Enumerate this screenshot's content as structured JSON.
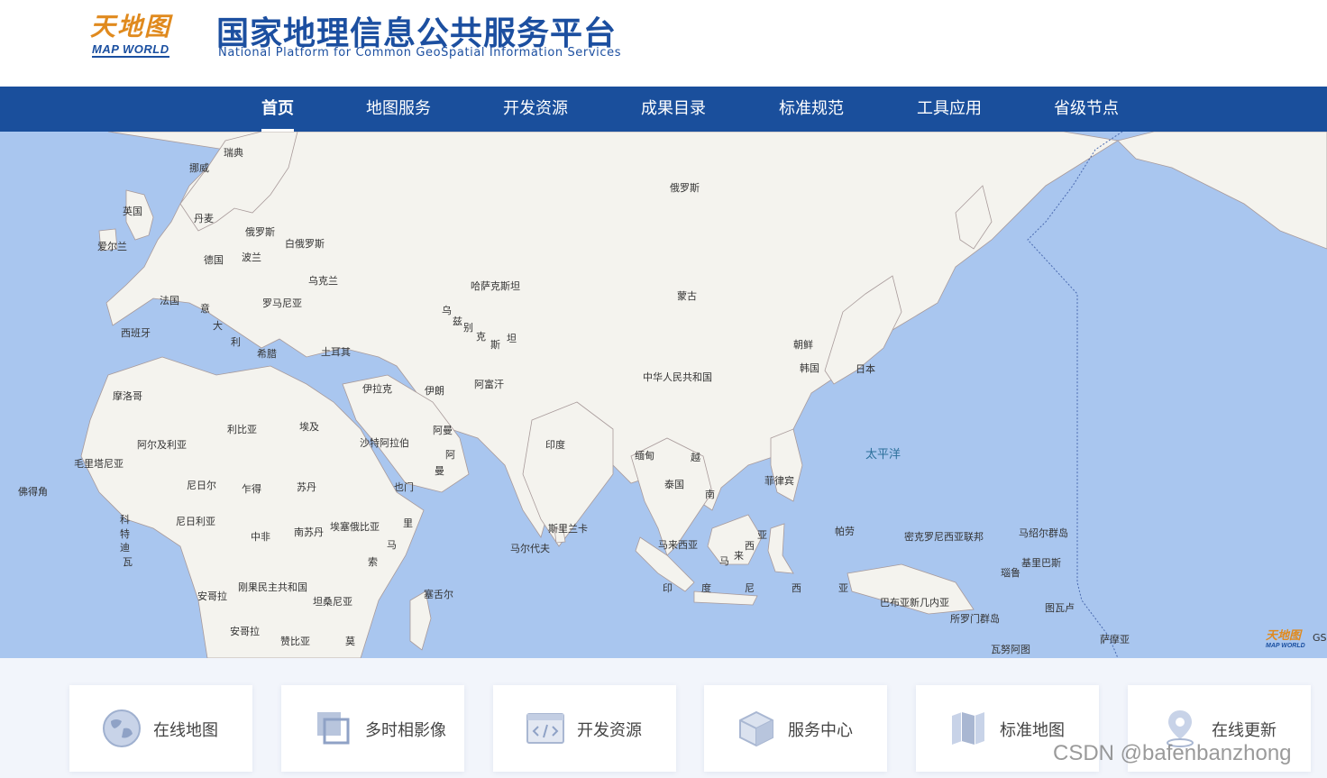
{
  "header": {
    "logo_cn": "天地图",
    "logo_en": "MAP WORLD",
    "title": "国家地理信息公共服务平台",
    "subtitle": "National Platform for Common GeoSpatial Information Services"
  },
  "nav": {
    "items": [
      {
        "label": "首页",
        "active": true
      },
      {
        "label": "地图服务"
      },
      {
        "label": "开发资源"
      },
      {
        "label": "成果目录"
      },
      {
        "label": "标准规范"
      },
      {
        "label": "工具应用"
      },
      {
        "label": "省级节点"
      }
    ]
  },
  "map": {
    "labels": [
      "瑞典",
      "挪威",
      "英国",
      "丹麦",
      "爱尔兰",
      "俄罗斯",
      "白俄罗斯",
      "波兰",
      "德国",
      "乌克兰",
      "法国",
      "意",
      "罗马尼亚",
      "大",
      "利",
      "西班牙",
      "希腊",
      "土耳其",
      "哈萨克斯坦",
      "乌",
      "兹",
      "别",
      "克",
      "斯",
      "坦",
      "蒙古",
      "俄罗斯",
      "朝鲜",
      "韩国",
      "日本",
      "中华人民共和国",
      "伊拉克",
      "伊朗",
      "阿富汗",
      "摩洛哥",
      "阿尔及利亚",
      "利比亚",
      "埃及",
      "沙特阿拉伯",
      "阿曼",
      "阿",
      "曼",
      "印度",
      "缅甸",
      "越",
      "泰国",
      "南",
      "菲律宾",
      "太平洋",
      "毛里塔尼亚",
      "尼日尔",
      "乍得",
      "苏丹",
      "也门",
      "佛得角",
      "科",
      "特",
      "迪",
      "瓦",
      "尼日利亚",
      "中非",
      "南苏丹",
      "埃塞俄比亚",
      "里",
      "马",
      "索",
      "斯里兰卡",
      "马尔代夫",
      "马来西亚",
      "亚",
      "西",
      "马",
      "来",
      "帕劳",
      "密克罗尼西亚联邦",
      "马绍尔群岛",
      "基里巴斯",
      "瑙鲁",
      "刚果民主共和国",
      "安哥拉",
      "坦桑尼亚",
      "塞舌尔",
      "印",
      "度",
      "尼",
      "西",
      "亚",
      "巴布亚新几内亚",
      "所罗门群岛",
      "图瓦卢",
      "安哥拉",
      "赞比亚",
      "莫",
      "瓦努阿图",
      "萨摩亚"
    ],
    "logo_cn": "天地图",
    "logo_en": "MAP WORLD",
    "gs": "GS"
  },
  "cards": [
    {
      "label": "在线地图",
      "icon": "globe-icon"
    },
    {
      "label": "多时相影像",
      "icon": "layers-icon"
    },
    {
      "label": "开发资源",
      "icon": "code-window-icon"
    },
    {
      "label": "服务中心",
      "icon": "cube-icon"
    },
    {
      "label": "标准地图",
      "icon": "folded-map-icon"
    },
    {
      "label": "在线更新",
      "icon": "map-pin-icon"
    }
  ],
  "watermark": "CSDN @bafenbanzhong",
  "colors": {
    "brand_blue": "#1c4fa0",
    "nav_blue": "#1a4f9c",
    "ocean": "#a9c6ef",
    "land": "#f4f3ee",
    "logo_orange": "#e08a1e"
  }
}
